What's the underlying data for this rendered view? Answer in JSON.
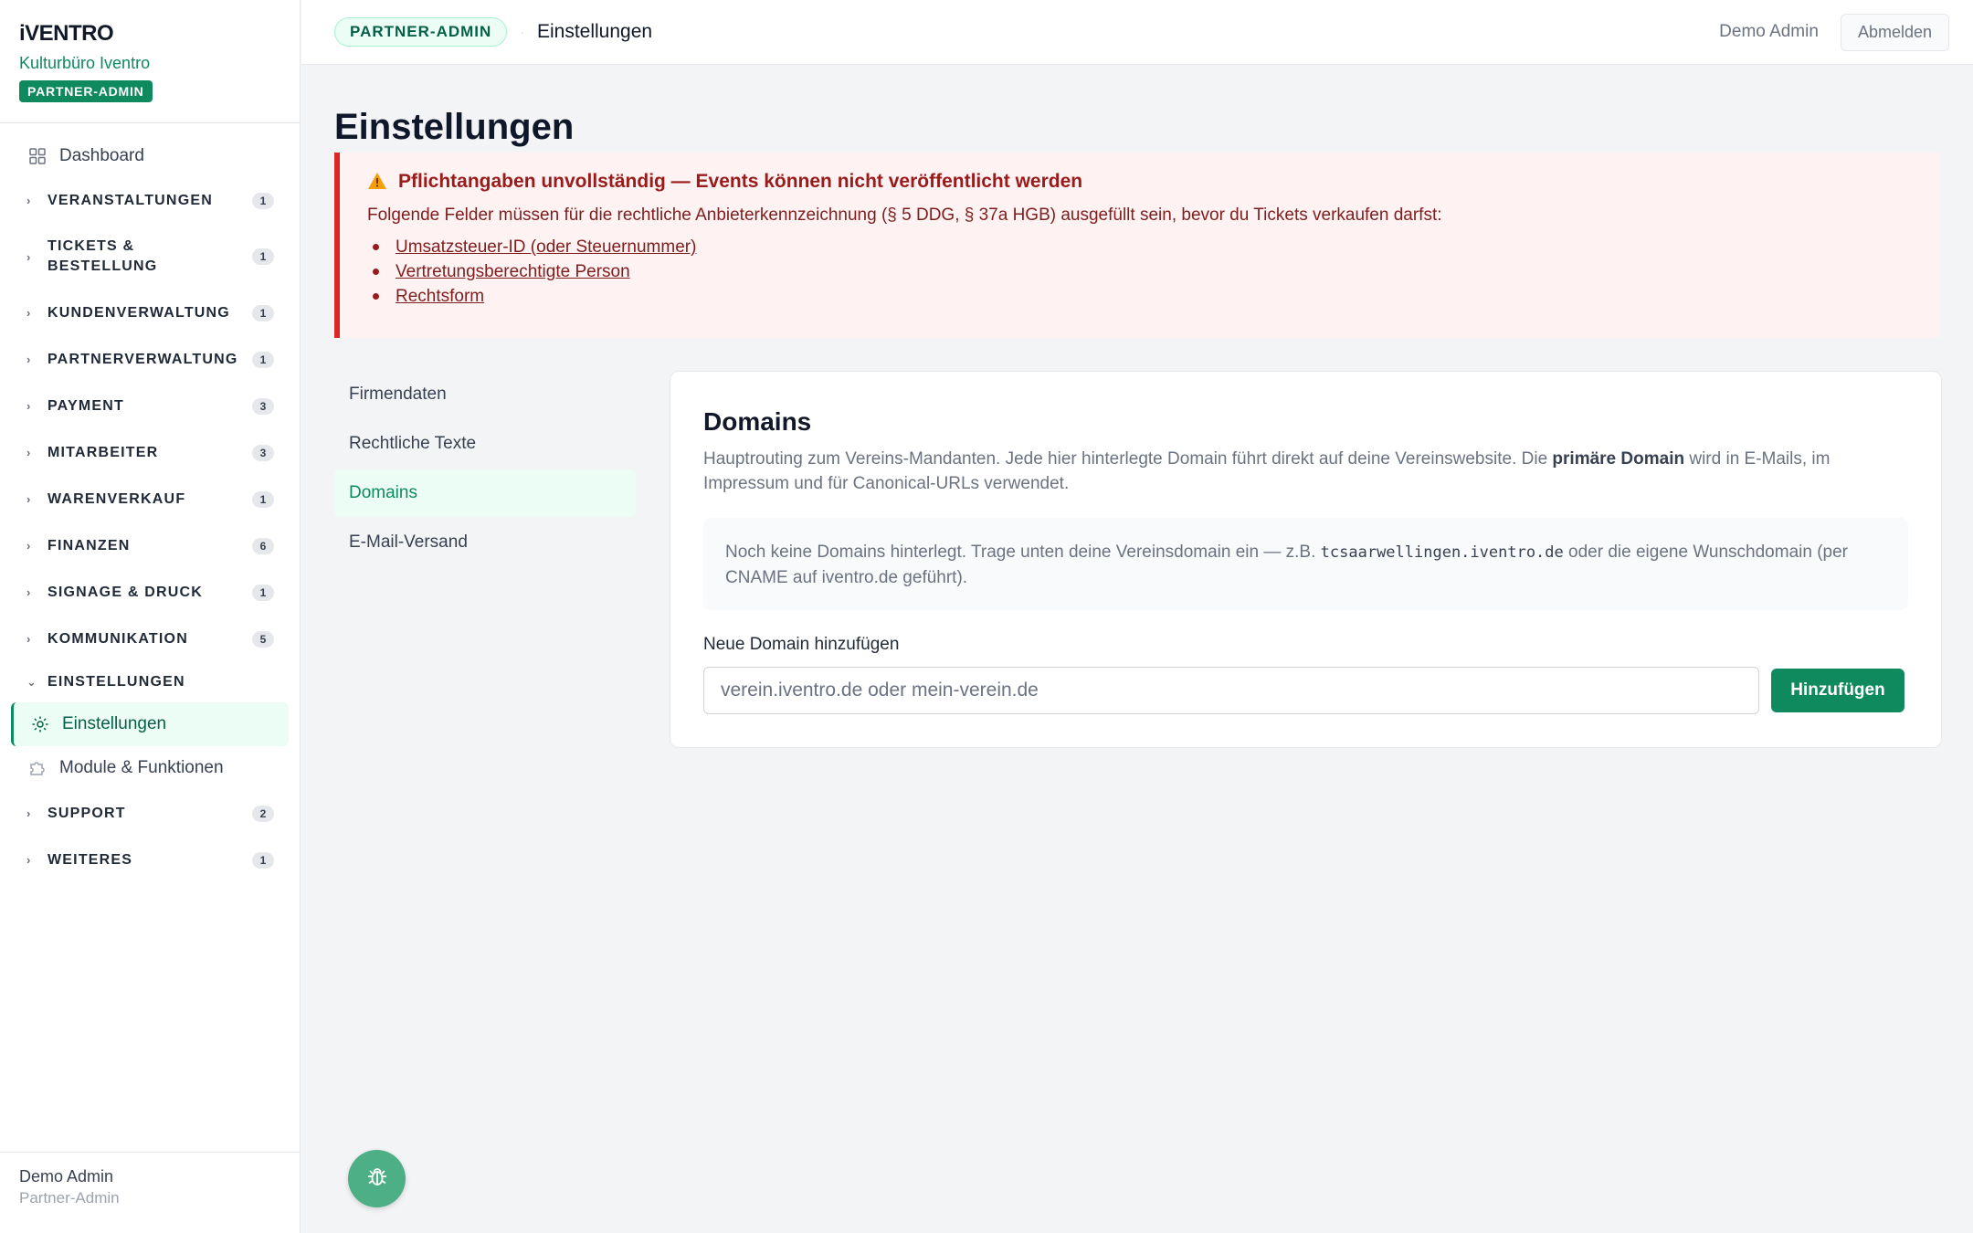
{
  "brand": {
    "logo": "iVENTRO",
    "org": "Kulturbüro Iventro",
    "role_badge": "PARTNER-ADMIN"
  },
  "nav": {
    "dashboard": "Dashboard",
    "groups": [
      {
        "label": "VERANSTALTUNGEN",
        "count": "1"
      },
      {
        "label": "TICKETS & BESTELLUNG",
        "count": "1"
      },
      {
        "label": "KUNDENVERWALTUNG",
        "count": "1"
      },
      {
        "label": "PARTNERVERWALTUNG",
        "count": "1"
      },
      {
        "label": "PAYMENT",
        "count": "3"
      },
      {
        "label": "MITARBEITER",
        "count": "3"
      },
      {
        "label": "WARENVERKAUF",
        "count": "1"
      },
      {
        "label": "FINANZEN",
        "count": "6"
      },
      {
        "label": "SIGNAGE & DRUCK",
        "count": "1"
      },
      {
        "label": "KOMMUNIKATION",
        "count": "5"
      }
    ],
    "settings_group": "EINSTELLUNGEN",
    "settings_items": [
      "Einstellungen",
      "Module & Funktionen"
    ],
    "after_groups": [
      {
        "label": "SUPPORT",
        "count": "2"
      },
      {
        "label": "WEITERES",
        "count": "1"
      }
    ]
  },
  "sidebar_footer": {
    "user": "Demo Admin",
    "role": "Partner-Admin"
  },
  "topbar": {
    "role_pill": "PARTNER-ADMIN",
    "breadcrumb": "Einstellungen",
    "user": "Demo Admin",
    "logout": "Abmelden"
  },
  "page": {
    "title": "Einstellungen"
  },
  "alert": {
    "title": "Pflichtangaben unvollständig — Events können nicht veröffentlicht werden",
    "text": "Folgende Felder müssen für die rechtliche Anbieterkennzeichnung (§ 5 DDG, § 37a HGB) ausgefüllt sein, bevor du Tickets verkaufen darfst:",
    "items": [
      "Umsatzsteuer-ID (oder Steuernummer)",
      "Vertretungsberechtigte Person",
      "Rechtsform"
    ]
  },
  "subnav": [
    "Firmendaten",
    "Rechtliche Texte",
    "Domains",
    "E-Mail-Versand"
  ],
  "domains": {
    "title": "Domains",
    "desc_1": "Hauptrouting zum Vereins-Mandanten. Jede hier hinterlegte Domain führt direkt auf deine Vereinswebsite. Die ",
    "desc_bold": "primäre Domain",
    "desc_2": " wird in E-Mails, im Impressum und für Canonical-URLs verwendet.",
    "empty_1": "Noch keine Domains hinterlegt. Trage unten deine Vereinsdomain ein — z.B. ",
    "empty_code": "tcsaarwellingen.iventro.de",
    "empty_2": " oder die eigene Wunschdomain (per CNAME auf iventro.de geführt).",
    "field_label": "Neue Domain hinzufügen",
    "input_placeholder": "verein.iventro.de oder mein-verein.de",
    "input_value": "",
    "add_button": "Hinzufügen"
  },
  "colors": {
    "accent": "#0f8a5f",
    "alert_bg": "#fef2f2",
    "alert_border": "#dc2626",
    "alert_text": "#991b1b"
  },
  "icons": {
    "dashboard": "grid-icon",
    "settings": "gear-icon",
    "modules": "puzzle-icon",
    "alert": "warning-icon",
    "fab": "bug-icon"
  }
}
